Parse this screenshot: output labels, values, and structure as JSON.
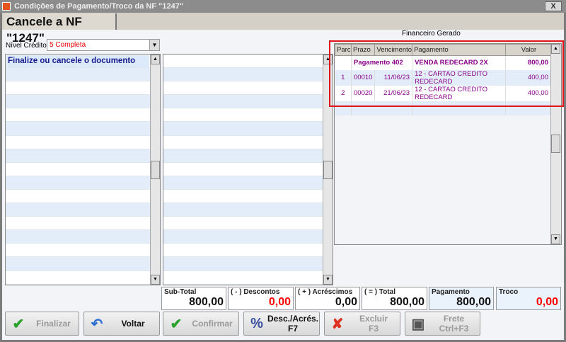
{
  "window": {
    "title": "Condições de Pagamento/Troco da NF \"1247\"",
    "close": "X"
  },
  "tab": {
    "label": "Cancele a NF \"1247\""
  },
  "nivel_credito": {
    "label": "Nível Crédito",
    "value": "5 Completa"
  },
  "left_grid": {
    "first_row": "Finalize ou cancele o documento"
  },
  "financeiro": {
    "title": "Financeiro Gerado",
    "columns": [
      "Parc",
      "Prazo",
      "Vencimento",
      "Pagamento",
      "Valor"
    ],
    "header_row": {
      "label": "Pagamento  402",
      "pagamento": "VENDA REDECARD 2X",
      "valor": "800,00"
    },
    "rows": [
      {
        "parc": "1",
        "prazo": "00010",
        "venc": "11/06/23",
        "pag": "12 - CARTAO CREDITO  REDECARD",
        "valor": "400,00"
      },
      {
        "parc": "2",
        "prazo": "00020",
        "venc": "21/06/23",
        "pag": "12 - CARTAO CREDITO  REDECARD",
        "valor": "400,00"
      }
    ]
  },
  "totals": [
    {
      "label": "Sub-Total",
      "value": "800,00",
      "color": "#111111"
    },
    {
      "label": "( - ) Descontos",
      "value": "0,00",
      "color": "#ff0000"
    },
    {
      "label": "( + ) Acréscimos",
      "value": "0,00",
      "color": "#111111"
    },
    {
      "label": "( = ) Total",
      "value": "800,00",
      "color": "#111111"
    },
    {
      "label": "Pagamento",
      "value": "800,00",
      "color": "#111111"
    },
    {
      "label": "Troco",
      "value": "0,00",
      "color": "#ff0000"
    }
  ],
  "buttons": {
    "finalizar": "Finalizar",
    "voltar": "Voltar",
    "confirmar": "Confirmar",
    "desc": "Desc./Acrés.",
    "desc_key": "F7",
    "excluir": "Excluir",
    "excluir_key": "F3",
    "frete": "Frete",
    "frete_key": "Ctrl+F3"
  }
}
